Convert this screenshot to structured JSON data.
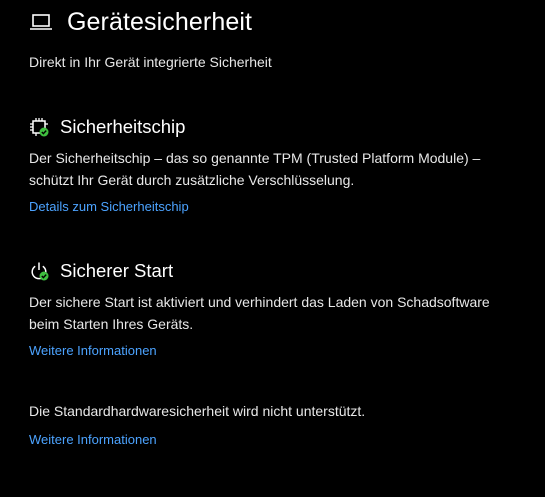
{
  "header": {
    "title": "Gerätesicherheit",
    "subtitle": "Direkt in Ihr Gerät integrierte Sicherheit",
    "icon": "laptop-icon"
  },
  "security_chip": {
    "title": "Sicherheitschip",
    "icon": "chip-check-icon",
    "description_line1": "Der Sicherheitschip – das so genannte TPM (Trusted Platform Module) –",
    "description_line2": "schützt Ihr Gerät durch zusätzliche Verschlüsselung.",
    "link": "Details zum Sicherheitschip"
  },
  "secure_boot": {
    "title": "Sicherer Start",
    "icon": "power-check-icon",
    "description_line1": "Der sichere Start ist aktiviert und verhindert das Laden von Schadsoftware",
    "description_line2": "beim Starten Ihres Geräts.",
    "link": "Weitere Informationen"
  },
  "hardware_security": {
    "description": "Die Standardhardwaresicherheit wird nicht unterstützt.",
    "link": "Weitere Informationen"
  },
  "colors": {
    "background": "#000000",
    "text": "#ffffff",
    "link": "#4ca3ff",
    "status_ok": "#3fbf3f"
  }
}
